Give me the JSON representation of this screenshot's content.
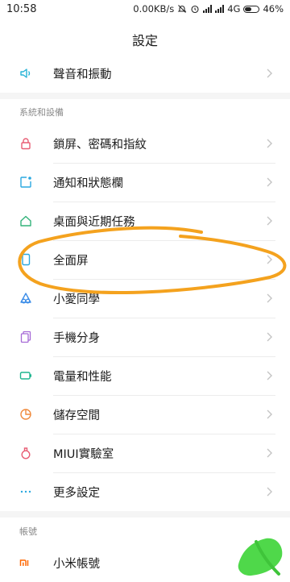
{
  "status_bar": {
    "time": "10:58",
    "network_speed": "0.00KB/s",
    "network_type": "4G",
    "battery_percent": "46%"
  },
  "page": {
    "title": "設定"
  },
  "items": [
    {
      "label": "聲音和振動",
      "icon": "speaker-icon",
      "color": "#27b3d6"
    },
    {
      "label": "鎖屏、密碼和指紋",
      "icon": "lock-icon",
      "color": "#e85d74"
    },
    {
      "label": "通知和狀態欄",
      "icon": "notification-icon",
      "color": "#2aa8e0"
    },
    {
      "label": "桌面與近期任務",
      "icon": "home-icon",
      "color": "#33b37a"
    },
    {
      "label": "全面屏",
      "icon": "fullscreen-icon",
      "color": "#2aa8e0"
    },
    {
      "label": "小愛同學",
      "icon": "xiaoai-icon",
      "color": "#3c8de8"
    },
    {
      "label": "手機分身",
      "icon": "dual-apps-icon",
      "color": "#a66ad6"
    },
    {
      "label": "電量和性能",
      "icon": "battery-icon",
      "color": "#1fb58f"
    },
    {
      "label": "儲存空間",
      "icon": "storage-icon",
      "color": "#f08a3c"
    },
    {
      "label": "MIUI實驗室",
      "icon": "lab-flask-icon",
      "color": "#e85d74"
    },
    {
      "label": "更多設定",
      "icon": "more-dots-icon",
      "color": "#2aa8e0"
    },
    {
      "label": "小米帳號",
      "icon": "mi-logo-icon",
      "color": "#ff6700"
    }
  ],
  "sections": {
    "system": "系統和設備",
    "account": "帳號"
  },
  "colors": {
    "annotation_orange": "#f4a21e",
    "annotation_green": "#4fd84a"
  }
}
